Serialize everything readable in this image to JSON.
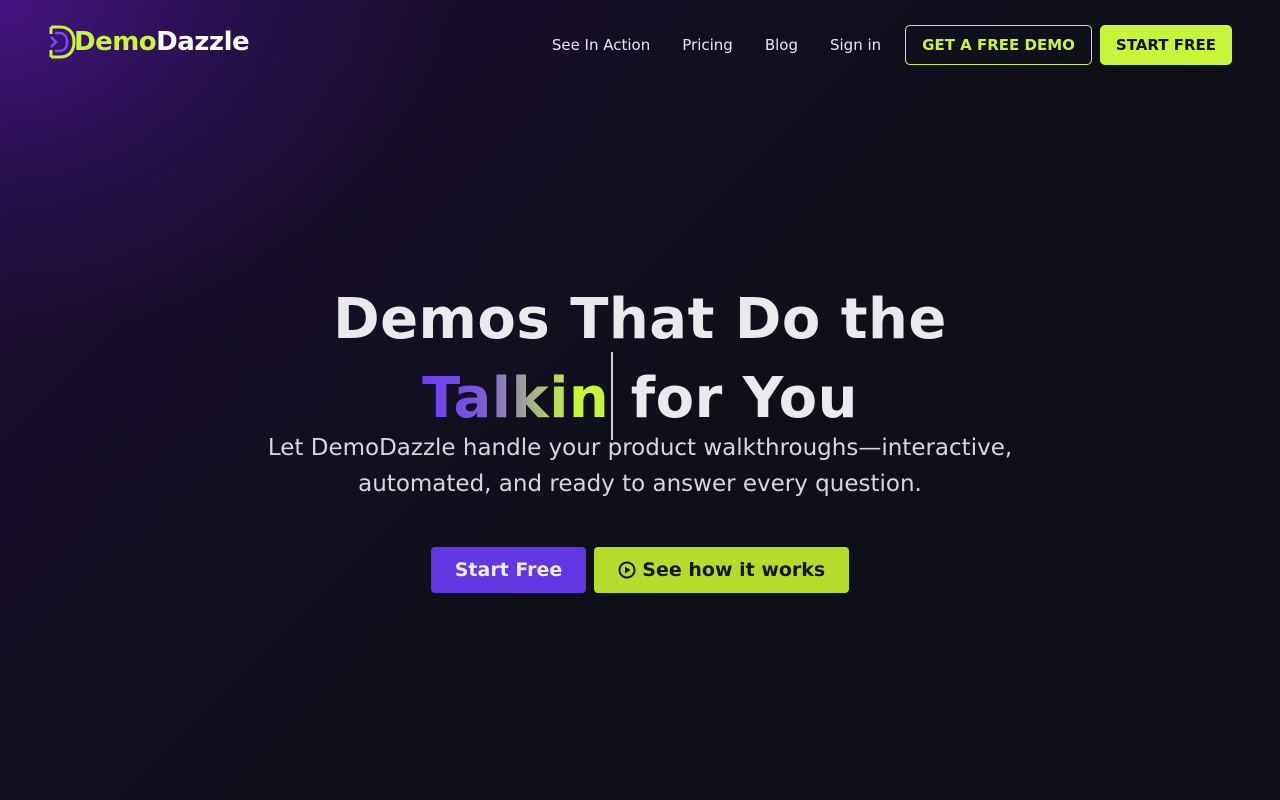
{
  "brand": {
    "name_part1": "Demo",
    "name_part2": "Dazzle",
    "logo_icon": "letter-d-logo-icon",
    "colors": {
      "accent": "#c8f53a",
      "primary": "#6236e0",
      "background": "#0f0f1a"
    }
  },
  "nav": {
    "links": [
      {
        "label": "See In Action"
      },
      {
        "label": "Pricing"
      },
      {
        "label": "Blog"
      },
      {
        "label": "Sign in"
      }
    ],
    "demo_button": "GET A FREE DEMO",
    "start_button": "START FREE"
  },
  "hero": {
    "title_line1": "Demos That Do the",
    "title_typed": "Talkin",
    "title_rest": "for You",
    "subtitle": "Let DemoDazzle handle your product walkthroughs—interactive, automated, and ready to answer every question.",
    "primary_cta": "Start Free",
    "secondary_cta": "See how it works",
    "secondary_icon": "play-circle-icon"
  }
}
